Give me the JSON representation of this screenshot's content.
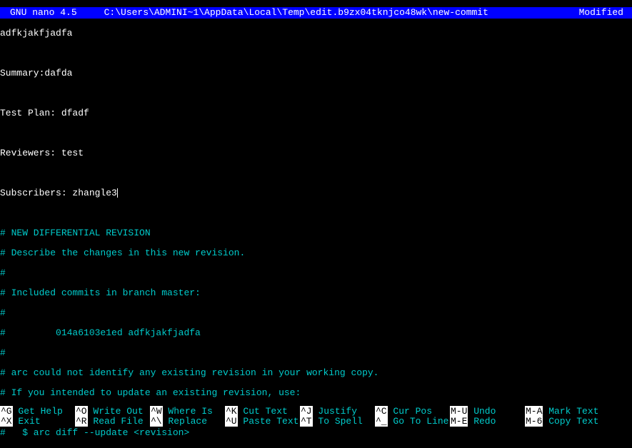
{
  "header": {
    "app": "GNU nano 4.5",
    "path": "C:\\Users\\ADMINI~1\\AppData\\Local\\Temp\\edit.b9zx04tknjco48wk\\new-commit",
    "status": "Modified"
  },
  "content": {
    "line1": "adfkjakfjadfa",
    "line2": "",
    "line3": "Summary:dafda",
    "line4": "",
    "line5": "Test Plan: dfadf",
    "line6": "",
    "line7": "Reviewers: test",
    "line8": "",
    "line9": "Subscribers: zhangle3",
    "line10": "",
    "c1": "# NEW DIFFERENTIAL REVISION",
    "c2": "# Describe the changes in this new revision.",
    "c3": "#",
    "c4": "# Included commits in branch master:",
    "c5": "#",
    "c6": "#         014a6103e1ed adfkjakfjadfa",
    "c7": "#",
    "c8": "# arc could not identify any existing revision in your working copy.",
    "c9": "# If you intended to update an existing revision, use:",
    "c10": "#",
    "c11": "#   $ arc diff --update <revision>"
  },
  "footer": {
    "row1": [
      {
        "key": "^G",
        "label": " Get Help"
      },
      {
        "key": "^O",
        "label": " Write Out"
      },
      {
        "key": "^W",
        "label": " Where Is"
      },
      {
        "key": "^K",
        "label": " Cut Text"
      },
      {
        "key": "^J",
        "label": " Justify"
      },
      {
        "key": "^C",
        "label": " Cur Pos"
      },
      {
        "key": "M-U",
        "label": " Undo"
      },
      {
        "key": "M-A",
        "label": " Mark Text"
      }
    ],
    "row2": [
      {
        "key": "^X",
        "label": " Exit"
      },
      {
        "key": "^R",
        "label": " Read File"
      },
      {
        "key": "^\\",
        "label": " Replace"
      },
      {
        "key": "^U",
        "label": " Paste Text"
      },
      {
        "key": "^T",
        "label": " To Spell"
      },
      {
        "key": "^_",
        "label": " Go To Line"
      },
      {
        "key": "M-E",
        "label": " Redo"
      },
      {
        "key": "M-6",
        "label": " Copy Text"
      }
    ]
  }
}
